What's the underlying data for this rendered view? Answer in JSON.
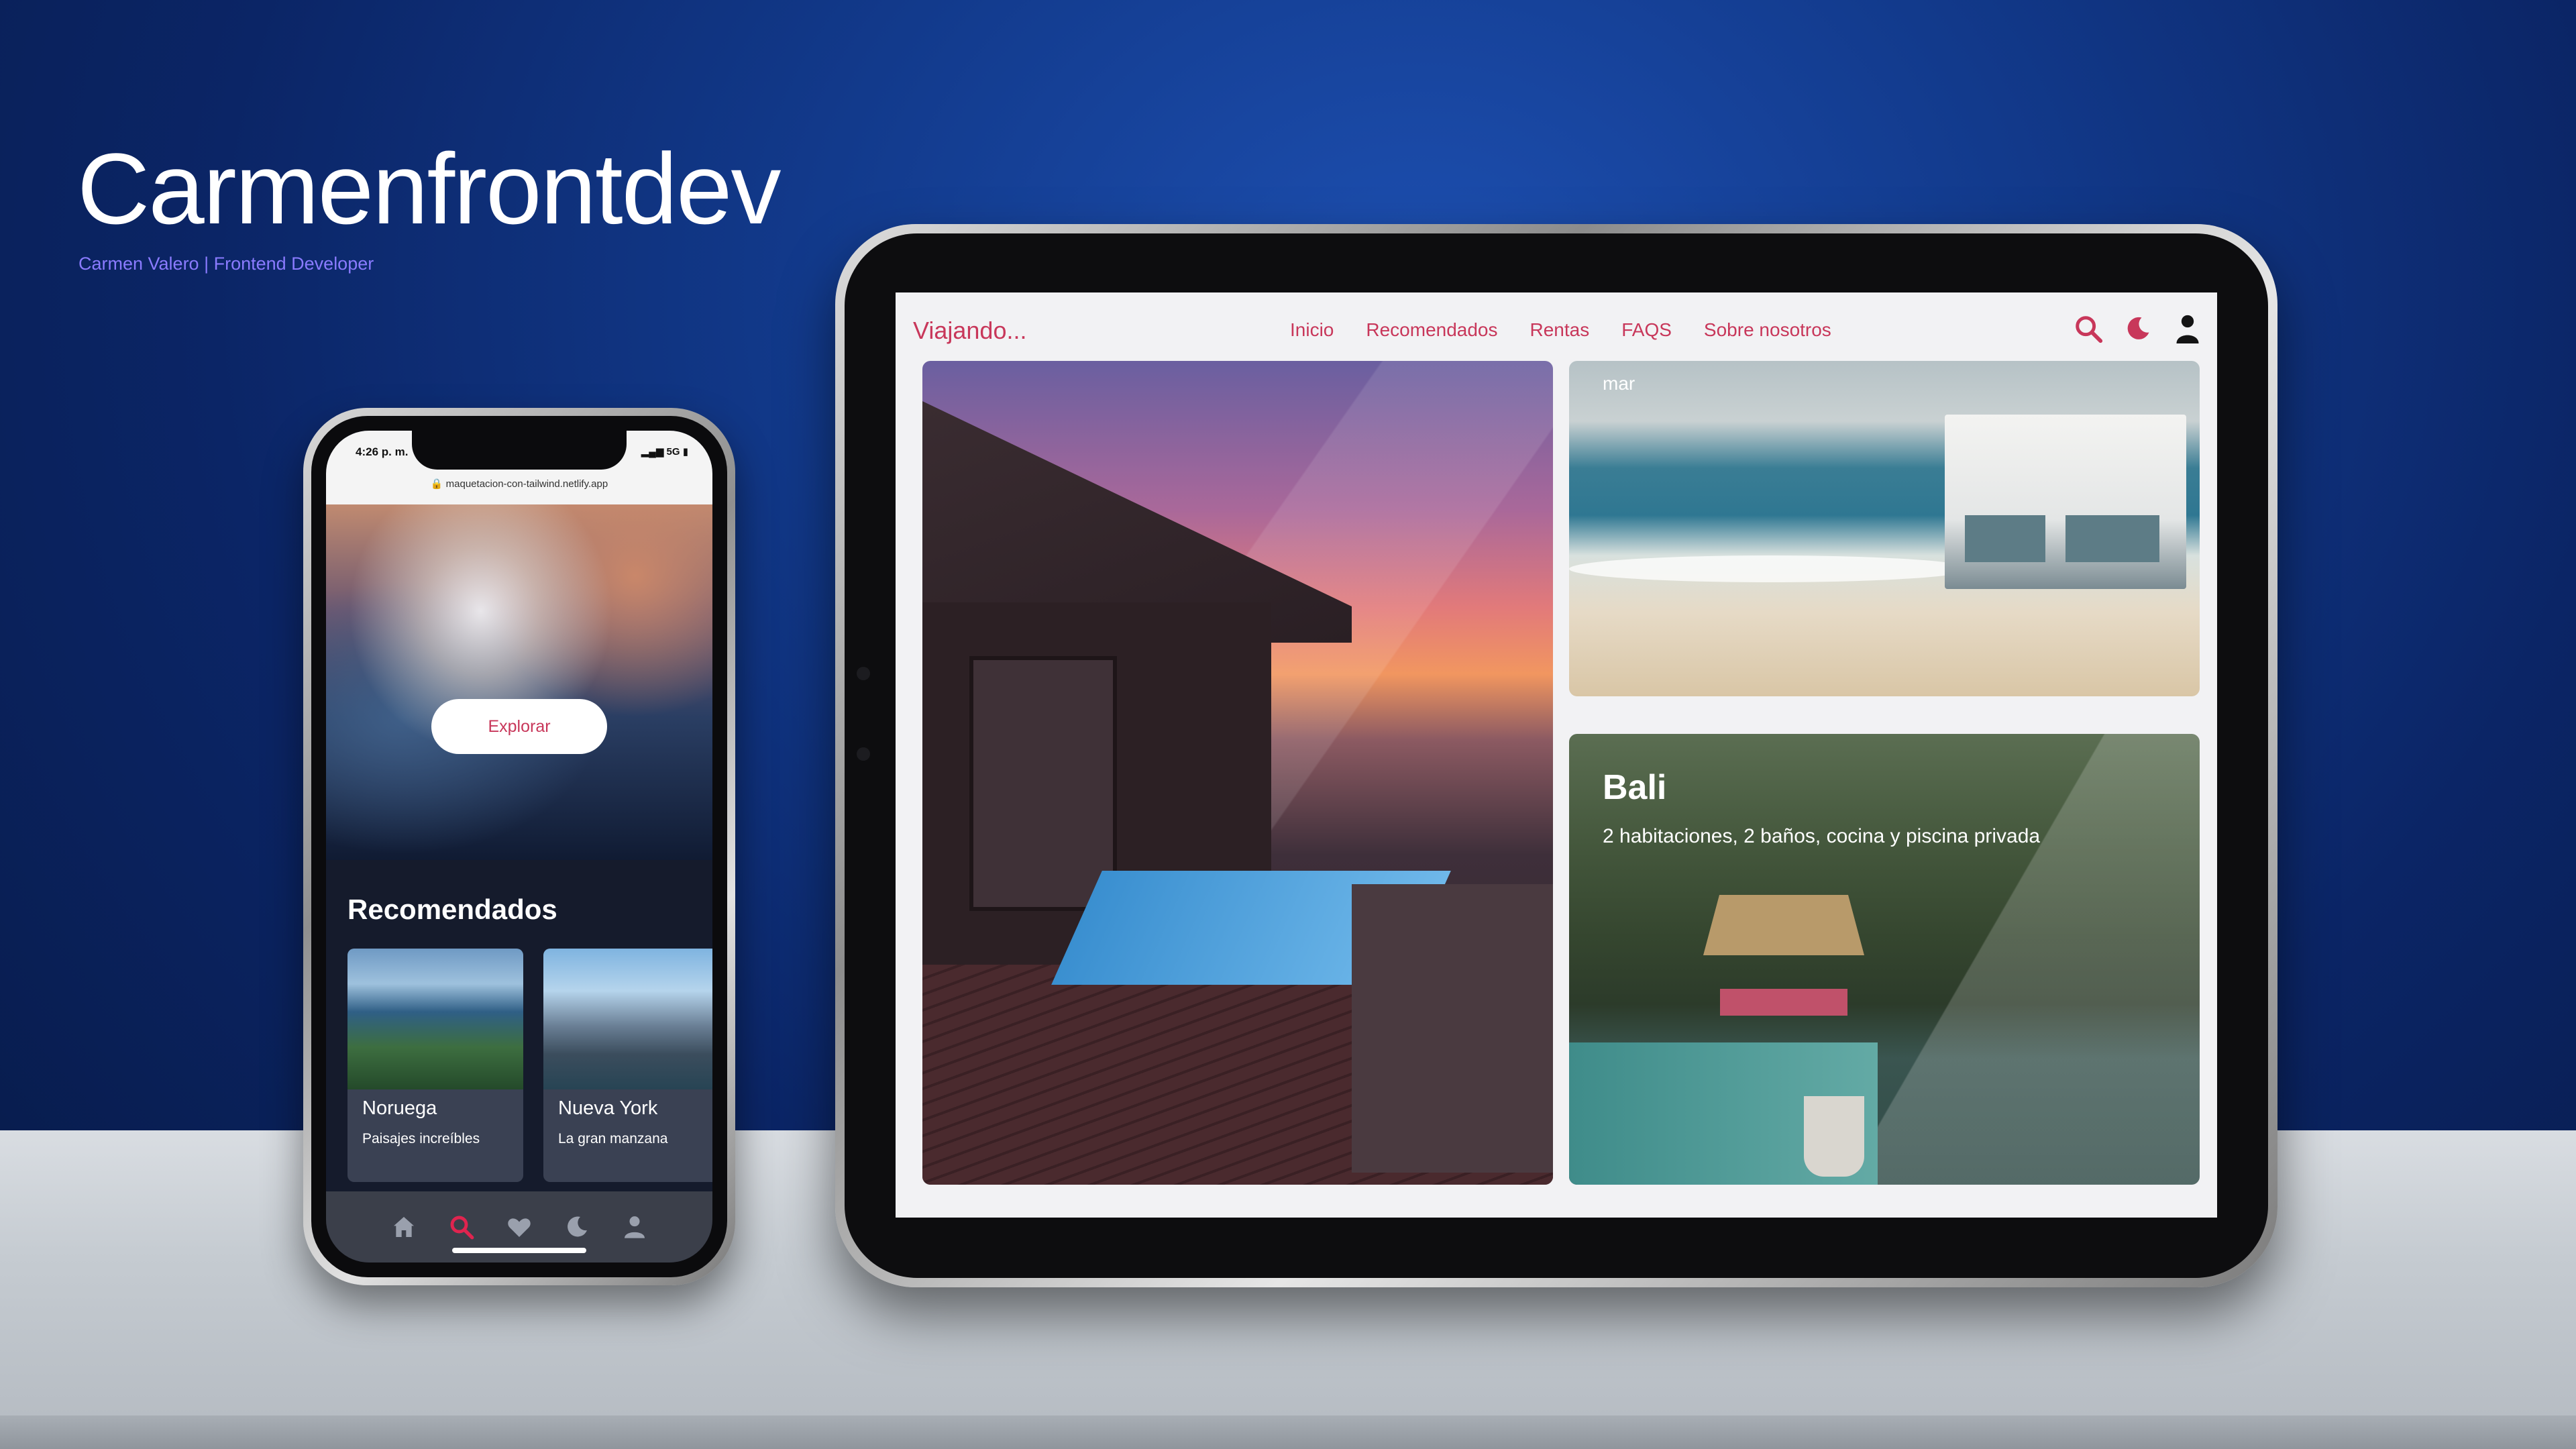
{
  "brand": {
    "title": "Carmenfrontdev",
    "subtitle": "Carmen Valero | Frontend Developer"
  },
  "phone": {
    "status": {
      "time": "4:26 p. m.",
      "signal": "5G",
      "url": "maquetacion-con-tailwind.netlify.app"
    },
    "hero_button": "Explorar",
    "section_title": "Recomendados",
    "cards": [
      {
        "title": "Noruega",
        "subtitle": "Paisajes increíbles"
      },
      {
        "title": "Nueva York",
        "subtitle": "La gran manzana"
      }
    ],
    "tabbar": [
      {
        "icon": "home-icon"
      },
      {
        "icon": "search-icon",
        "active": true
      },
      {
        "icon": "heart-icon"
      },
      {
        "icon": "moon-icon"
      },
      {
        "icon": "user-icon"
      }
    ],
    "accent_color": "#e0244f"
  },
  "tablet": {
    "logo": "Viajando...",
    "nav_links": [
      "Inicio",
      "Recomendados",
      "Rentas",
      "FAQS",
      "Sobre nosotros"
    ],
    "nav_icons": [
      "search-icon",
      "moon-icon",
      "user-icon"
    ],
    "top_card_label": "mar",
    "bottom_card": {
      "title": "Bali",
      "description": "2 habitaciones, 2 baños, cocina y piscina privada"
    },
    "accent_color": "#c8375a"
  }
}
